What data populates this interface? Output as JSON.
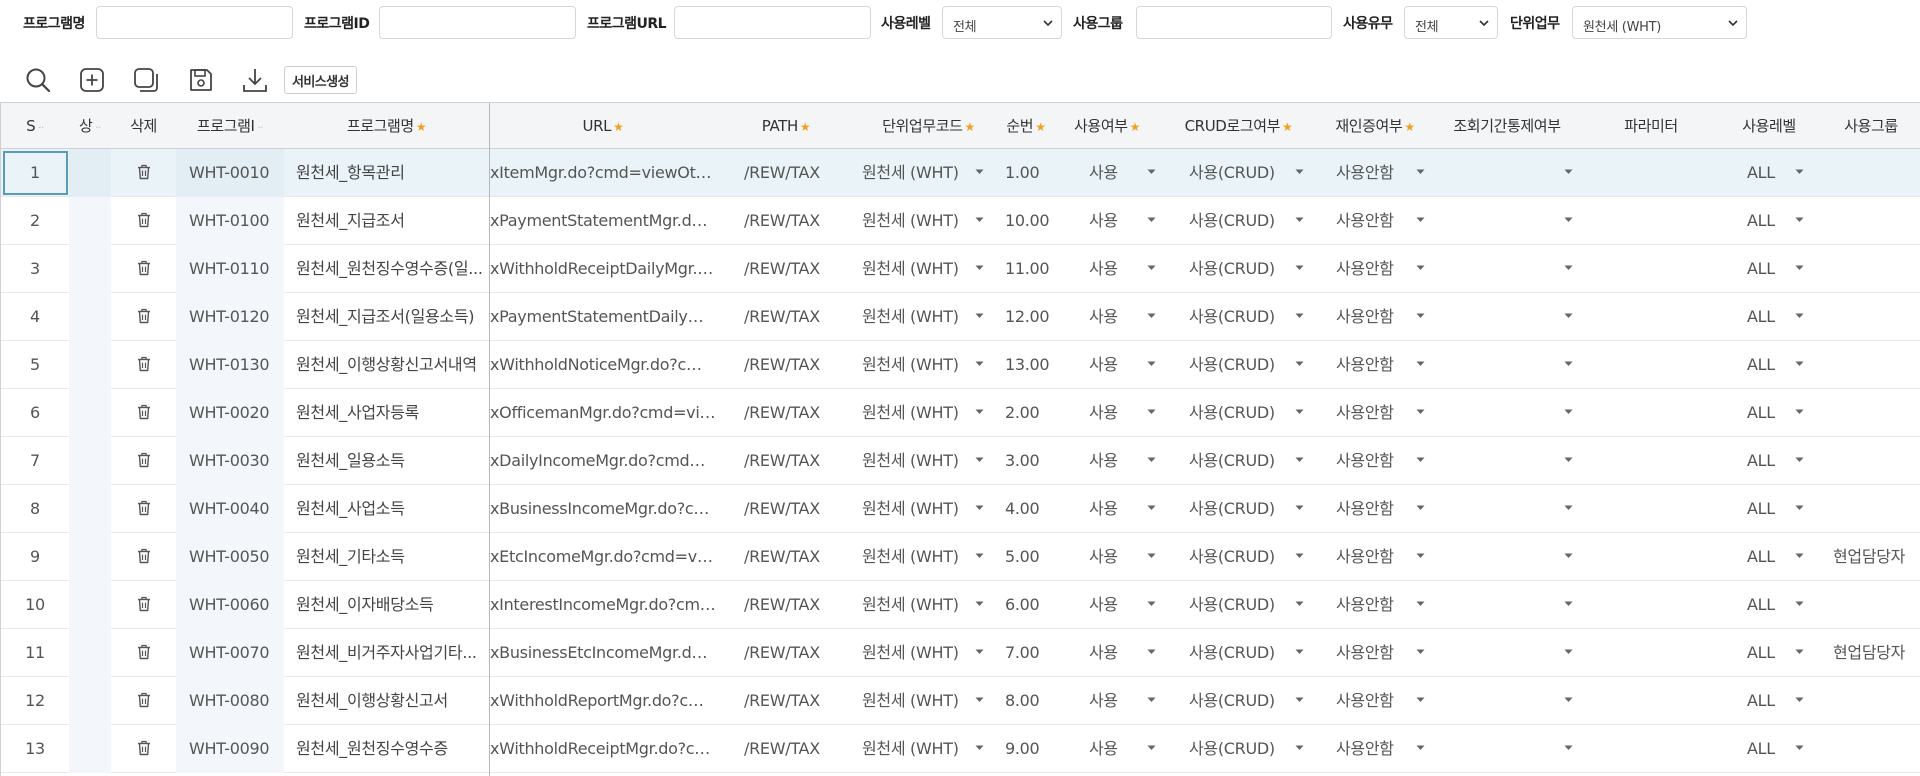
{
  "search": {
    "program_name_label": "프로그램명",
    "program_name_value": "",
    "program_id_label": "프로그램ID",
    "program_id_value": "",
    "program_url_label": "프로그램URL",
    "program_url_value": "",
    "use_level_label": "사용레벨",
    "use_level_value": "전체",
    "use_group_label": "사용그룹",
    "use_group_value": "",
    "use_yn_label": "사용유무",
    "use_yn_value": "전체",
    "unit_task_label": "단위업무",
    "unit_task_value": "원천세 (WHT)"
  },
  "toolbar": {
    "icons": [
      "search-icon",
      "add-icon",
      "copy-icon",
      "save-icon",
      "download-icon"
    ],
    "create_service_label": "서비스생성"
  },
  "grid": {
    "columns": {
      "seq": "S",
      "status": "상",
      "delete": "삭제",
      "program_id": "프로그램I",
      "program_name": "프로그램명",
      "url": "URL",
      "path": "PATH",
      "unit_code": "단위업무코드",
      "order": "순번",
      "use_yn": "사용여부",
      "crud_log": "CRUD로그여부",
      "reauth": "재인증여부",
      "period_ctrl": "조회기간통제여부",
      "param": "파라미터",
      "use_level": "사용레벨",
      "use_group": "사용그룹"
    },
    "required_mark": "★",
    "rows": [
      {
        "seq": "1",
        "id": "WHT-0010",
        "name": "원천세_항목관리",
        "url": "xItemMgr.do?cmd=viewOtax...",
        "path": "/REW/TAX",
        "unit": "원천세 (WHT)",
        "order": "1.00",
        "use": "사용",
        "crud": "사용(CRUD)",
        "reauth": "사용안함",
        "period": "",
        "param": "",
        "level": "ALL",
        "group": ""
      },
      {
        "seq": "2",
        "id": "WHT-0100",
        "name": "원천세_지급조서",
        "url": "xPaymentStatementMgr.do? ...",
        "path": "/REW/TAX",
        "unit": "원천세 (WHT)",
        "order": "10.00",
        "use": "사용",
        "crud": "사용(CRUD)",
        "reauth": "사용안함",
        "period": "",
        "param": "",
        "level": "ALL",
        "group": ""
      },
      {
        "seq": "3",
        "id": "WHT-0110",
        "name": "원천세_원천징수영수증(일...",
        "url": "xWithholdReceiptDailyMgr.d...",
        "path": "/REW/TAX",
        "unit": "원천세 (WHT)",
        "order": "11.00",
        "use": "사용",
        "crud": "사용(CRUD)",
        "reauth": "사용안함",
        "period": "",
        "param": "",
        "level": "ALL",
        "group": ""
      },
      {
        "seq": "4",
        "id": "WHT-0120",
        "name": "원천세_지급조서(일용소득)",
        "url": "xPaymentStatementDailyMgr...",
        "path": "/REW/TAX",
        "unit": "원천세 (WHT)",
        "order": "12.00",
        "use": "사용",
        "crud": "사용(CRUD)",
        "reauth": "사용안함",
        "period": "",
        "param": "",
        "level": "ALL",
        "group": ""
      },
      {
        "seq": "5",
        "id": "WHT-0130",
        "name": "원천세_이행상황신고서내역",
        "url": "xWithholdNoticeMgr.do?cmd...",
        "path": "/REW/TAX",
        "unit": "원천세 (WHT)",
        "order": "13.00",
        "use": "사용",
        "crud": "사용(CRUD)",
        "reauth": "사용안함",
        "period": "",
        "param": "",
        "level": "ALL",
        "group": ""
      },
      {
        "seq": "6",
        "id": "WHT-0020",
        "name": "원천세_사업자등록",
        "url": "xOfficemanMgr.do?cmd=vie...",
        "path": "/REW/TAX",
        "unit": "원천세 (WHT)",
        "order": "2.00",
        "use": "사용",
        "crud": "사용(CRUD)",
        "reauth": "사용안함",
        "period": "",
        "param": "",
        "level": "ALL",
        "group": ""
      },
      {
        "seq": "7",
        "id": "WHT-0030",
        "name": "원천세_일용소득",
        "url": "xDailyIncomeMgr.do?cmd=vi...",
        "path": "/REW/TAX",
        "unit": "원천세 (WHT)",
        "order": "3.00",
        "use": "사용",
        "crud": "사용(CRUD)",
        "reauth": "사용안함",
        "period": "",
        "param": "",
        "level": "ALL",
        "group": ""
      },
      {
        "seq": "8",
        "id": "WHT-0040",
        "name": "원천세_사업소득",
        "url": "xBusinessIncomeMgr.do?cm...",
        "path": "/REW/TAX",
        "unit": "원천세 (WHT)",
        "order": "4.00",
        "use": "사용",
        "crud": "사용(CRUD)",
        "reauth": "사용안함",
        "period": "",
        "param": "",
        "level": "ALL",
        "group": ""
      },
      {
        "seq": "9",
        "id": "WHT-0050",
        "name": "원천세_기타소득",
        "url": "xEtcIncomeMgr.do?cmd=vie...",
        "path": "/REW/TAX",
        "unit": "원천세 (WHT)",
        "order": "5.00",
        "use": "사용",
        "crud": "사용(CRUD)",
        "reauth": "사용안함",
        "period": "",
        "param": "",
        "level": "ALL",
        "group": "현업담당자"
      },
      {
        "seq": "10",
        "id": "WHT-0060",
        "name": "원천세_이자배당소득",
        "url": "xInterestIncomeMgr.do?cmd...",
        "path": "/REW/TAX",
        "unit": "원천세 (WHT)",
        "order": "6.00",
        "use": "사용",
        "crud": "사용(CRUD)",
        "reauth": "사용안함",
        "period": "",
        "param": "",
        "level": "ALL",
        "group": ""
      },
      {
        "seq": "11",
        "id": "WHT-0070",
        "name": "원천세_비거주자사업기타...",
        "url": "xBusinessEtcIncomeMgr.do? ...",
        "path": "/REW/TAX",
        "unit": "원천세 (WHT)",
        "order": "7.00",
        "use": "사용",
        "crud": "사용(CRUD)",
        "reauth": "사용안함",
        "period": "",
        "param": "",
        "level": "ALL",
        "group": "현업담당자"
      },
      {
        "seq": "12",
        "id": "WHT-0080",
        "name": "원천세_이행상황신고서",
        "url": "xWithholdReportMgr.do?cm...",
        "path": "/REW/TAX",
        "unit": "원천세 (WHT)",
        "order": "8.00",
        "use": "사용",
        "crud": "사용(CRUD)",
        "reauth": "사용안함",
        "period": "",
        "param": "",
        "level": "ALL",
        "group": ""
      },
      {
        "seq": "13",
        "id": "WHT-0090",
        "name": "원천세_원천징수영수증",
        "url": "xWithholdReceiptMgr.do?cm...",
        "path": "/REW/TAX",
        "unit": "원천세 (WHT)",
        "order": "9.00",
        "use": "사용",
        "crud": "사용(CRUD)",
        "reauth": "사용안함",
        "period": "",
        "param": "",
        "level": "ALL",
        "group": ""
      }
    ]
  },
  "colors": {
    "required_star": "#f0a020",
    "selected_row": "#e9f3f8",
    "header_bg": "#f4f5f7",
    "focus_border": "#5a9bb5"
  }
}
